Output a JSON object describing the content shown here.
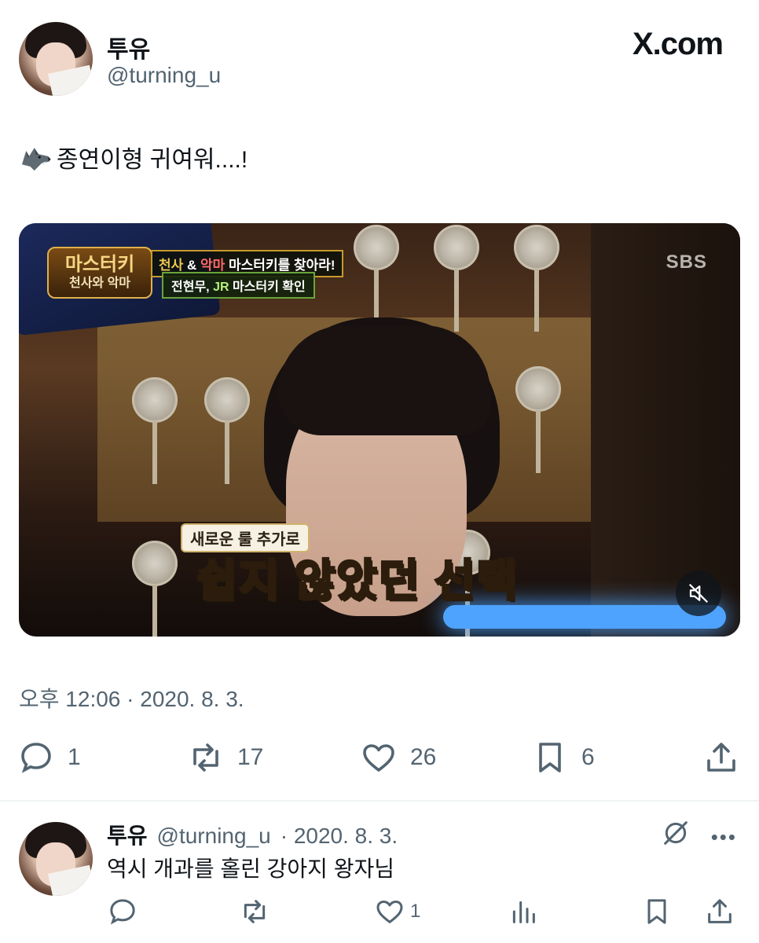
{
  "header": {
    "display_name": "투유",
    "handle": "@turning_u",
    "site_logo": "X.com"
  },
  "tweet": {
    "emoji": "wolf-emoji",
    "text": "종연이형 귀여워....!",
    "timestamp": "오후 12:06 · 2020. 8. 3."
  },
  "media": {
    "show_logo_main": "마스터키",
    "show_logo_sub": "천사와 악마",
    "caption_top": {
      "part1": "천사",
      "amp": " & ",
      "part2": "악마",
      "rest": " 마스터키를 찾아라!"
    },
    "caption_second": {
      "names": "전현무, ",
      "jr": "JR",
      "rest": " 마스터키 확인"
    },
    "broadcaster": "SBS",
    "subtitle_small": "새로운 룰 추가로",
    "subtitle_big": "쉽지 않았던 선택",
    "mute_icon": "speaker-muted-icon"
  },
  "actions": {
    "reply_count": "1",
    "retweet_count": "17",
    "like_count": "26",
    "bookmark_count": "6"
  },
  "reply": {
    "display_name": "투유",
    "handle": "@turning_u",
    "date": "· 2020. 8. 3.",
    "text": "역시 개과를 홀린 강아지 왕자님",
    "like_count": "1"
  },
  "colors": {
    "text_primary": "#0f1419",
    "text_secondary": "#536471",
    "divider": "#eff3f4"
  }
}
